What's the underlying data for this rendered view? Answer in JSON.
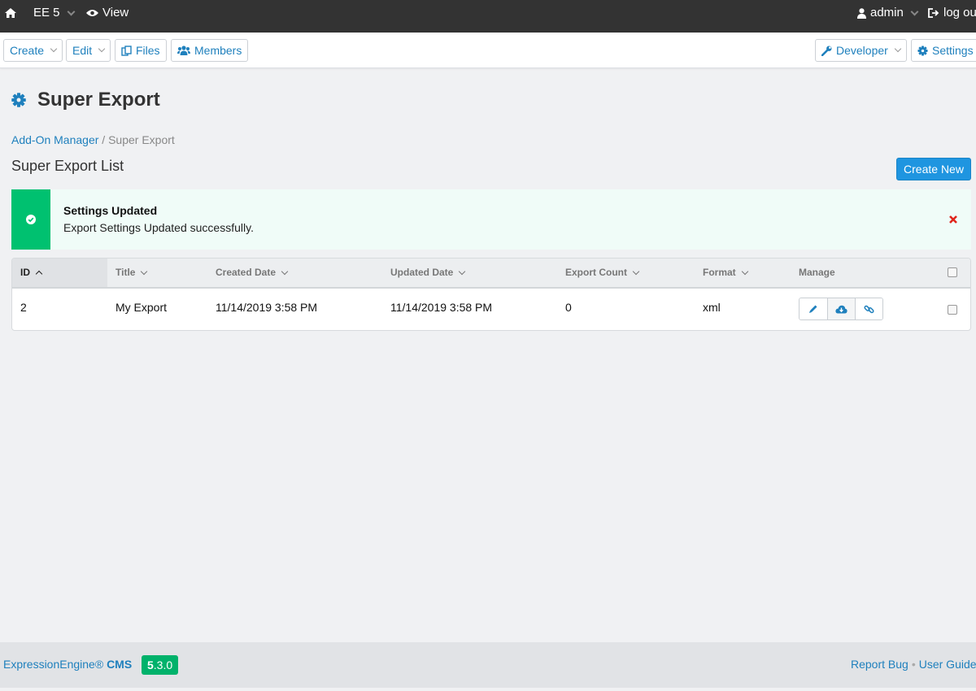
{
  "topbar": {
    "site_name": "EE 5",
    "view_label": "View",
    "user_label": "admin",
    "logout_label": "log out"
  },
  "navbar": {
    "create_label": "Create",
    "edit_label": "Edit",
    "files_label": "Files",
    "members_label": "Members",
    "developer_label": "Developer",
    "settings_label": "Settings"
  },
  "page": {
    "title": "Super Export",
    "breadcrumb_parent": "Add-On Manager",
    "breadcrumb_sep": "/",
    "breadcrumb_current": "Super Export",
    "list_heading": "Super Export List",
    "create_new_label": "Create New"
  },
  "alert": {
    "title": "Settings Updated",
    "message": "Export Settings Updated successfully."
  },
  "table": {
    "columns": {
      "id": "ID",
      "title": "Title",
      "created": "Created Date",
      "updated": "Updated Date",
      "count": "Export Count",
      "format": "Format",
      "manage": "Manage"
    },
    "rows": [
      {
        "id": "2",
        "title": "My Export",
        "created": "11/14/2019 3:58 PM",
        "updated": "11/14/2019 3:58 PM",
        "count": "0",
        "format": "xml"
      }
    ]
  },
  "footer": {
    "brand": "ExpressionEngine®",
    "brand_bold": "CMS",
    "version_major": "5",
    "version_rest": ".3.0",
    "report_bug": "Report Bug",
    "link_sep": "•",
    "user_guide": "User Guide"
  },
  "colors": {
    "link": "#1f80bd",
    "success": "#00c170",
    "primary_button": "#1f95e0",
    "topbar": "#333333",
    "danger": "#e0251b"
  },
  "icons": {
    "home": "home-icon",
    "view": "eye-icon",
    "user": "user-icon",
    "logout": "logout-icon",
    "files": "files-icon",
    "members": "members-icon",
    "developer": "wrench-icon",
    "settings": "gear-icon",
    "alert": "check-circle-icon",
    "close": "close-icon",
    "edit": "pencil-icon",
    "download": "cloud-download-icon",
    "link": "link-icon"
  }
}
